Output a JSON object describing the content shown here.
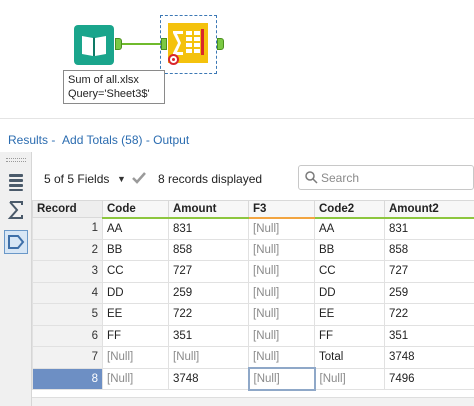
{
  "canvas": {
    "annotation_line1": "Sum of all.xlsx",
    "annotation_line2": "Query='Sheet3$'"
  },
  "results": {
    "title_prefix": "Results -",
    "title_tool": "Add Totals (58) - Output"
  },
  "toolbar": {
    "fields_selector": "5 of 5 Fields",
    "records_displayed": "8 records displayed",
    "search_placeholder": "Search"
  },
  "table": {
    "columns": [
      "Record",
      "Code",
      "Amount",
      "F3",
      "Code2",
      "Amount2"
    ],
    "rows": [
      [
        "1",
        "AA",
        "831",
        "[Null]",
        "AA",
        "831"
      ],
      [
        "2",
        "BB",
        "858",
        "[Null]",
        "BB",
        "858"
      ],
      [
        "3",
        "CC",
        "727",
        "[Null]",
        "CC",
        "727"
      ],
      [
        "4",
        "DD",
        "259",
        "[Null]",
        "DD",
        "259"
      ],
      [
        "5",
        "EE",
        "722",
        "[Null]",
        "EE",
        "722"
      ],
      [
        "6",
        "FF",
        "351",
        "[Null]",
        "FF",
        "351"
      ],
      [
        "7",
        "[Null]",
        "[Null]",
        "[Null]",
        "Total",
        "3748"
      ],
      [
        "8",
        "[Null]",
        "3748",
        "[Null]",
        "[Null]",
        "7496"
      ]
    ],
    "selected_record": "8"
  },
  "colors": {
    "link": "#2b6cb0",
    "input_tool": "#1aa58c",
    "summarize_tool": "#e6b800",
    "connector": "#6fba2c",
    "selected_row": "#6d8fc4"
  },
  "icons": [
    "book-icon",
    "summarize-icon",
    "error-icon",
    "table-view-icon",
    "metadata-icon",
    "tag-icon",
    "checkmark-icon",
    "search-icon",
    "chevron-down-icon"
  ]
}
